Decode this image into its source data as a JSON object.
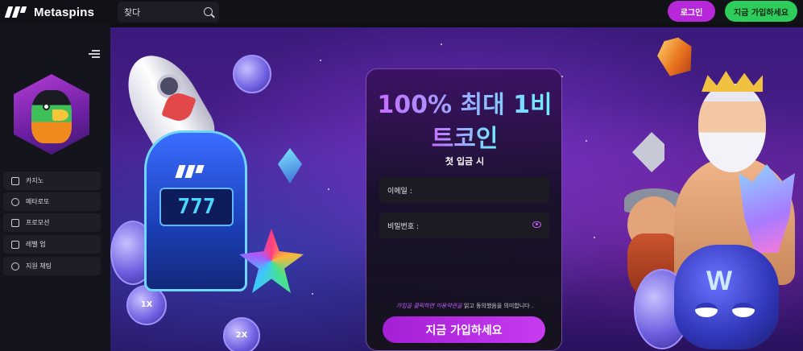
{
  "header": {
    "brand_name": "Metaspins",
    "search_placeholder": "찾다",
    "login_label": "로그인",
    "signup_label": "지금 가입하세요"
  },
  "sidebar": {
    "items": [
      {
        "label": "카지노",
        "icon": "casino-icon"
      },
      {
        "label": "메타로또",
        "icon": "lottery-icon"
      },
      {
        "label": "프로모션",
        "icon": "promotion-icon"
      },
      {
        "label": "레벨 업",
        "icon": "level-up-icon"
      },
      {
        "label": "지원 채팅",
        "icon": "headset-icon"
      }
    ]
  },
  "banner": {
    "slot_digits": "777",
    "coin_labels": [
      "1X",
      "2X"
    ]
  },
  "signup_card": {
    "headline_line1": "100% 최대 1비",
    "headline_line2": "트코인",
    "subhead": "첫 입금 시",
    "email_label": "이메일 :",
    "password_label": "비밀번호 :",
    "terms_link": "가입을 클릭하면 이용약관을",
    "terms_rest": " 읽고 동의했음을 의미합니다 .",
    "cta_label": "지금 가입하세요"
  },
  "colors": {
    "accent_purple": "#b628d9",
    "signup_green": "#2ecc5a",
    "headline_gradient_start": "#c66bff",
    "headline_gradient_end": "#6cf0ff"
  }
}
